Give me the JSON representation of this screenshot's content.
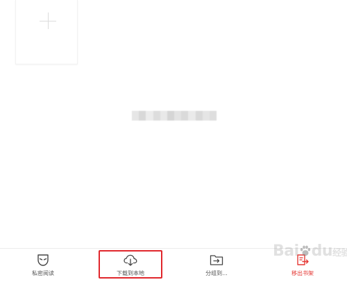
{
  "bookshelf": {
    "add_card": {
      "icon": "plus-icon"
    },
    "center_text_obscured": true,
    "blur_colors": [
      "#e6e6e6",
      "#d8d8d8",
      "#ececec",
      "#dddddd",
      "#e9e9e9",
      "#d5d5d5",
      "#e3e3e3",
      "#dadada",
      "#eaeaea",
      "#d9d9d9",
      "#e5e5e5",
      "#dedede"
    ]
  },
  "toolbar": {
    "private_read": {
      "label": "私密阅读",
      "icon": "mask-icon"
    },
    "download": {
      "label": "下载到本地",
      "icon": "cloud-download-icon"
    },
    "group": {
      "label": "分组到...",
      "icon": "folder-move-icon"
    },
    "remove": {
      "label": "移出书架",
      "icon": "remove-shelf-icon"
    }
  },
  "colors": {
    "accent_red": "#e53935",
    "highlight_border": "#e0262b",
    "label_gray": "#555555",
    "icon_gray": "#444444"
  },
  "watermark": {
    "text_main": "Bai",
    "text_du": "du",
    "text_suffix": "经验"
  }
}
